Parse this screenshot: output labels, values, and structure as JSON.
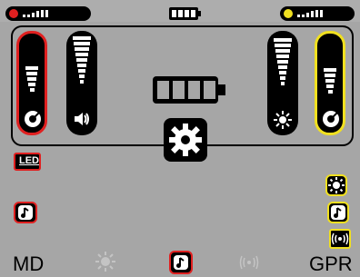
{
  "top_bar": {
    "left_indicator_color": "#e02020",
    "right_indicator_color": "#f0e020",
    "battery_icon": "battery-icon"
  },
  "panel": {
    "sliders": [
      {
        "name": "left-sensitivity",
        "icon": "gauge-icon",
        "accent": "#e02020"
      },
      {
        "name": "left-volume",
        "icon": "speaker-icon",
        "accent": "none"
      },
      {
        "name": "right-brightness",
        "icon": "sun-icon",
        "accent": "none"
      },
      {
        "name": "right-sensitivity",
        "icon": "gauge-icon",
        "accent": "#f0e020"
      }
    ],
    "battery_icon": "battery-icon",
    "settings_icon": "gear-icon"
  },
  "left_side": {
    "led_label": "LED",
    "icons": [
      "led-icon",
      "music-note-icon"
    ]
  },
  "right_side": {
    "icons": [
      "sun-icon",
      "music-note-icon",
      "vibration-icon"
    ]
  },
  "bottom_bar": {
    "left_label": "MD",
    "right_label": "GPR",
    "icons": [
      "sun-icon",
      "music-note-icon",
      "vibration-icon"
    ]
  }
}
